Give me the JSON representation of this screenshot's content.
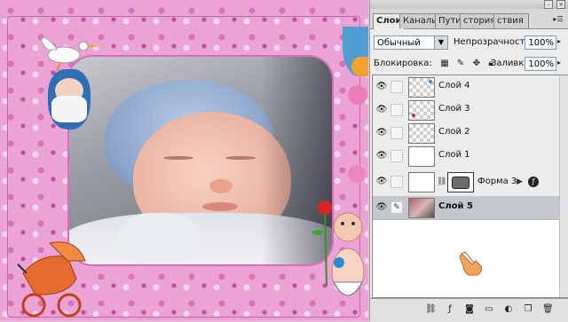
{
  "panel": {
    "tabs": [
      {
        "label": "Слои",
        "active": true
      },
      {
        "label": "Каналы",
        "active": false
      },
      {
        "label": "Пути",
        "active": false
      },
      {
        "label": "История",
        "active": false
      },
      {
        "label": "Операции",
        "active": false
      }
    ],
    "tab_display": [
      "Слои",
      "Каналы",
      "Пути",
      "стория",
      "ствия"
    ],
    "blend_mode": "Обычный",
    "opacity_label": "Непрозрачность:",
    "opacity_value": "100%",
    "lock_label": "Блокировка:",
    "fill_label": "Заливка:",
    "fill_value": "100%",
    "layers": [
      {
        "name": "Слой 4",
        "visible": true,
        "selected": false,
        "thumb": "transparent",
        "icon": ""
      },
      {
        "name": "Слой 3",
        "visible": true,
        "selected": false,
        "thumb": "transparent",
        "icon": ""
      },
      {
        "name": "Слой 2",
        "visible": true,
        "selected": false,
        "thumb": "transparent",
        "icon": ""
      },
      {
        "name": "Слой 1",
        "visible": true,
        "selected": false,
        "thumb": "white",
        "icon": ""
      },
      {
        "name": "Форма 3",
        "visible": true,
        "selected": false,
        "thumb": "white",
        "icon": "fx"
      },
      {
        "name": "Слой 5",
        "visible": true,
        "selected": true,
        "thumb": "photo",
        "icon": "brush"
      }
    ]
  },
  "icons": {
    "eye": "eye-icon",
    "chain": "chain-link-icon",
    "brush": "brush-icon",
    "fx": "layer-style-icon",
    "panel_menu": "panel-menu-icon",
    "lock_transparent": "lock-transparency-icon",
    "lock_image": "lock-image-icon",
    "lock_position": "lock-position-icon",
    "lock_all": "lock-all-icon",
    "bottom": [
      "link-layers-icon",
      "add-style-icon",
      "add-mask-icon",
      "new-group-icon",
      "adjustment-layer-icon",
      "new-layer-icon",
      "trash-icon"
    ]
  },
  "colors": {
    "selected_row": "#c3c8cd",
    "panel_bg": "#ececec",
    "canvas_pink": "#eaa3d4"
  }
}
